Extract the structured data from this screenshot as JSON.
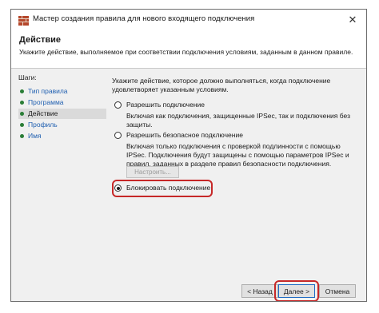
{
  "window": {
    "title": "Мастер создания правила для нового входящего подключения",
    "close_glyph": "✕"
  },
  "header": {
    "title": "Действие",
    "subtitle": "Укажите действие, выполняемое при соответствии подключения условиям, заданным в данном правиле."
  },
  "steps": {
    "title": "Шаги:",
    "items": [
      {
        "label": "Тип правила",
        "current": false
      },
      {
        "label": "Программа",
        "current": false
      },
      {
        "label": "Действие",
        "current": true
      },
      {
        "label": "Профиль",
        "current": false
      },
      {
        "label": "Имя",
        "current": false
      }
    ]
  },
  "content": {
    "intro": "Укажите действие, которое должно выполняться, когда подключение удовлетворяет указанным условиям.",
    "options": [
      {
        "label": "Разрешить подключение",
        "description": "Включая как подключения, защищенные IPSec, так и подключения без защиты.",
        "checked": false
      },
      {
        "label": "Разрешить безопасное подключение",
        "description": "Включая только подключения с проверкой подлинности с помощью IPSec. Подключения будут защищены с помощью параметров IPSec и правил, заданных в разделе правил безопасности подключения.",
        "checked": false
      },
      {
        "label": "Блокировать подключение",
        "description": "",
        "checked": true
      }
    ],
    "settings_button": "Настроить..."
  },
  "buttons": {
    "back": "< Назад",
    "next": "Далее >",
    "cancel": "Отмена"
  },
  "colors": {
    "highlight": "#c62828",
    "link": "#1f5fb0",
    "step_dot": "#2a7d36"
  },
  "icons": {
    "app": "firewall-app-icon",
    "close": "close-icon"
  }
}
